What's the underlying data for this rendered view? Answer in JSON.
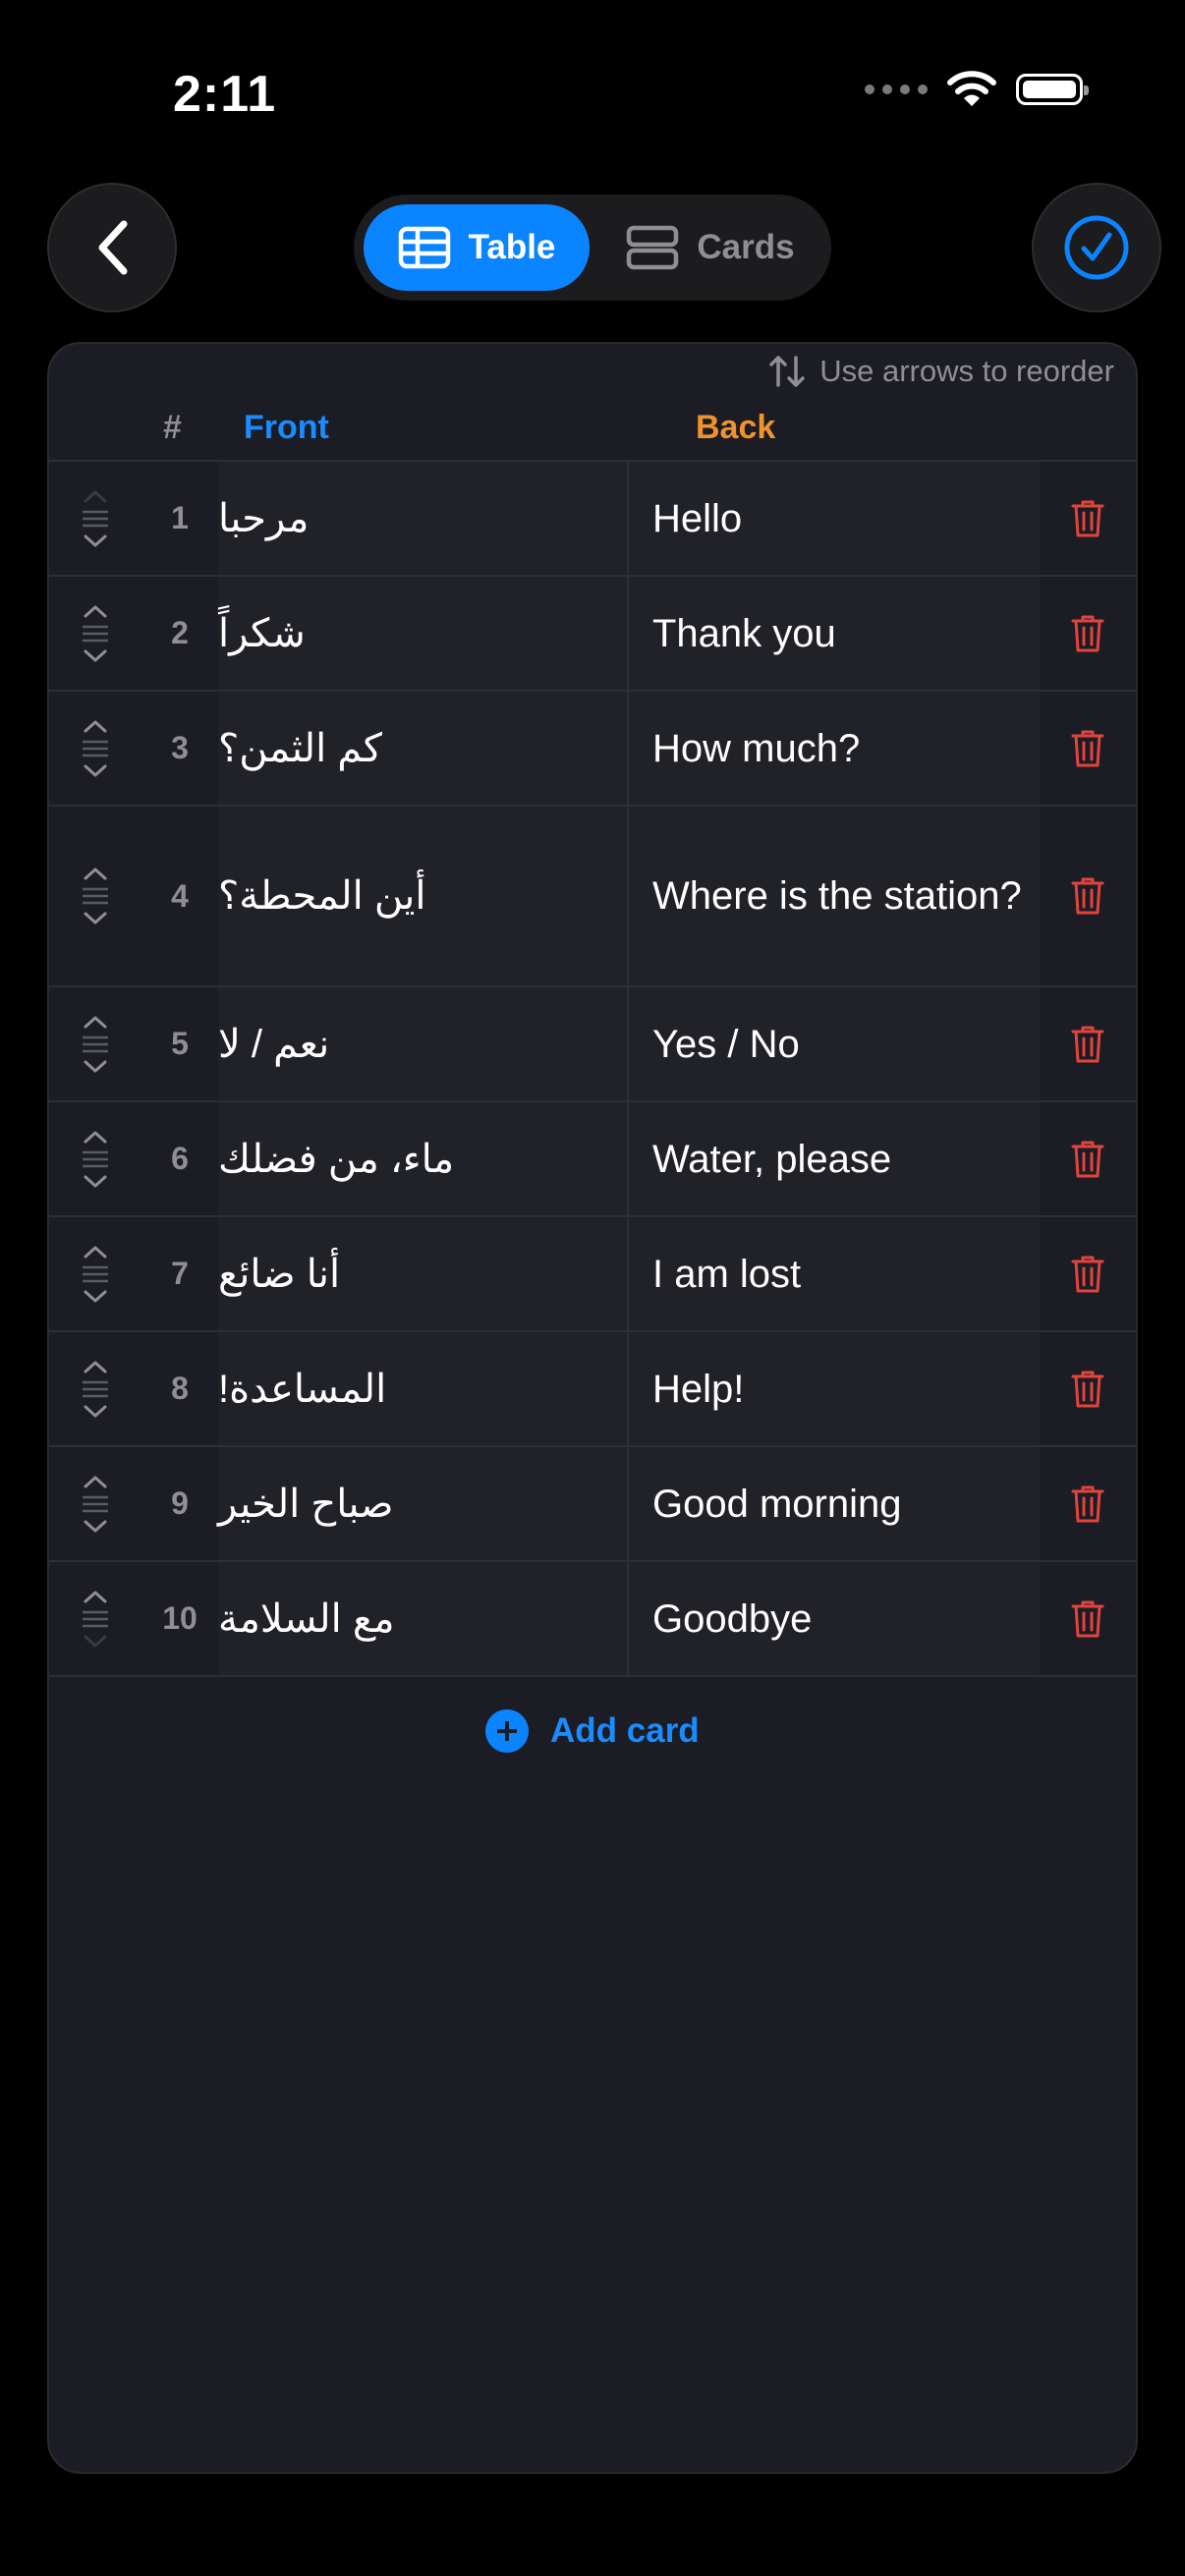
{
  "status": {
    "time": "2:11"
  },
  "header": {
    "segments": [
      {
        "label": "Table",
        "selected": true,
        "icon": "table-icon"
      },
      {
        "label": "Cards",
        "selected": false,
        "icon": "cards-icon"
      }
    ],
    "back_icon": "chevron-left-icon",
    "confirm_icon": "checkmark-circle-icon"
  },
  "table": {
    "hint": "Use arrows to reorder",
    "headers": {
      "num": "#",
      "front": "Front",
      "back": "Back"
    },
    "rows": [
      {
        "num": "1",
        "front": "مرحبا",
        "back": "Hello"
      },
      {
        "num": "2",
        "front": "شكراً",
        "back": "Thank you"
      },
      {
        "num": "3",
        "front": "كم الثمن؟",
        "back": "How much?"
      },
      {
        "num": "4",
        "front": "أين المحطة؟",
        "back": "Where is the station?"
      },
      {
        "num": "5",
        "front": "نعم / لا",
        "back": "Yes / No"
      },
      {
        "num": "6",
        "front": "ماء، من فضلك",
        "back": "Water, please"
      },
      {
        "num": "7",
        "front": "أنا ضائع",
        "back": "I am lost"
      },
      {
        "num": "8",
        "front": "المساعدة!",
        "back": "Help!"
      },
      {
        "num": "9",
        "front": "صباح الخير",
        "back": "Good morning"
      },
      {
        "num": "10",
        "front": "مع السلامة",
        "back": "Goodbye"
      }
    ],
    "add_label": "Add card"
  },
  "colors": {
    "accent": "#0a84ff",
    "front_header": "#1a8cff",
    "back_header": "#f0922e",
    "delete": "#e0443e"
  }
}
